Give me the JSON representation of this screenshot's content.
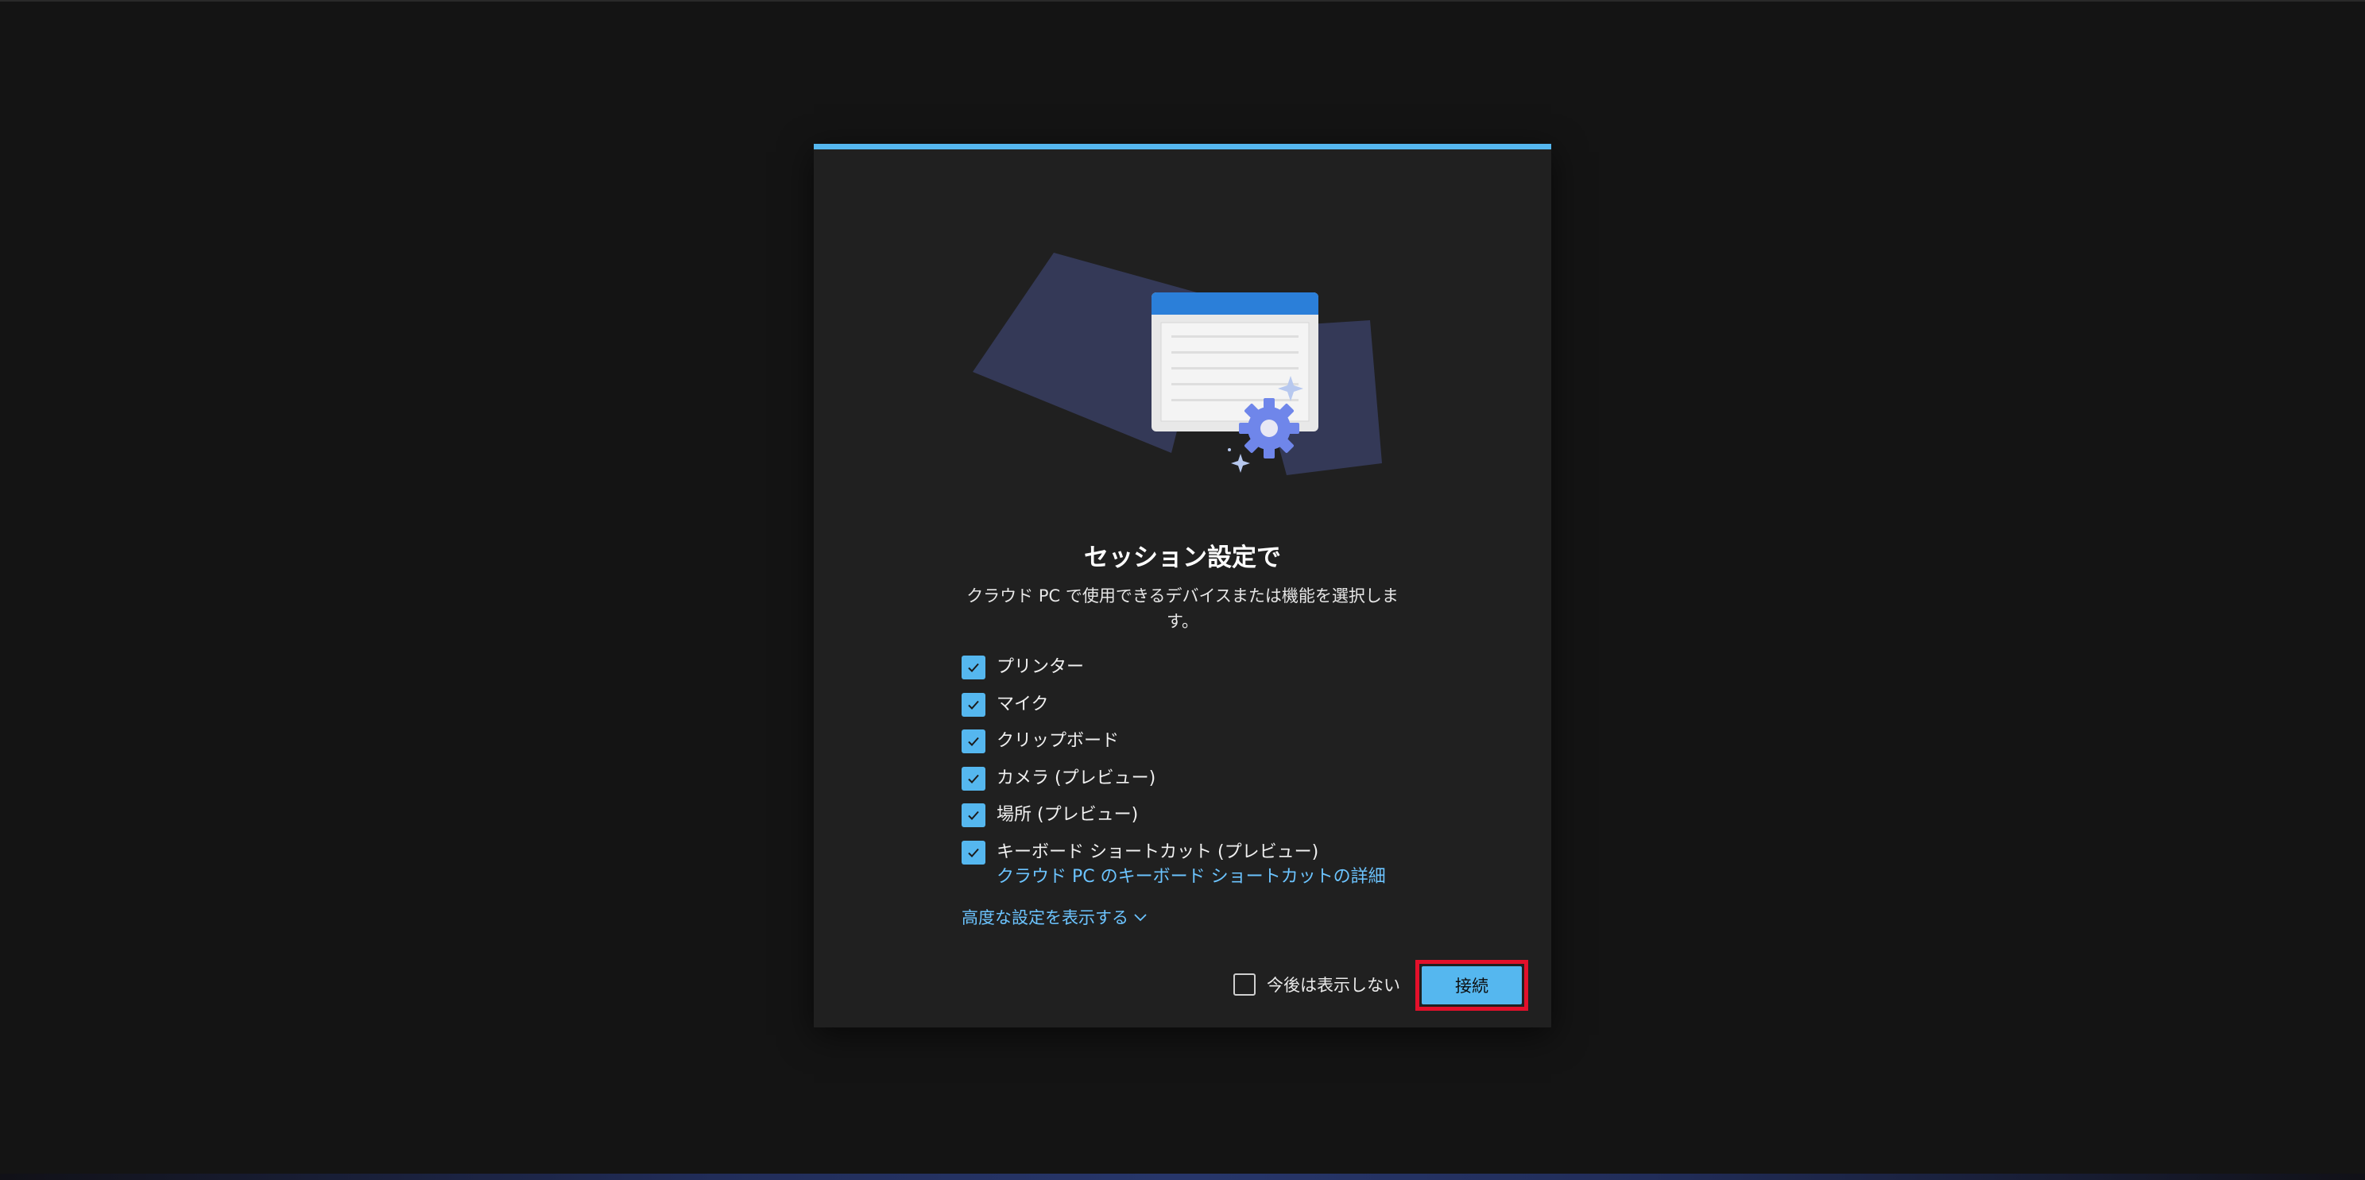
{
  "dialog": {
    "title": "セッション設定で",
    "description": "クラウド PC で使用できるデバイスまたは機能を選択します。",
    "options": [
      {
        "label": "プリンター",
        "checked": true
      },
      {
        "label": "マイク",
        "checked": true
      },
      {
        "label": "クリップボード",
        "checked": true
      },
      {
        "label": "カメラ (プレビュー)",
        "checked": true
      },
      {
        "label": "場所 (プレビュー)",
        "checked": true
      },
      {
        "label": "キーボード ショートカット (プレビュー)",
        "checked": true,
        "link": "クラウド PC のキーボード ショートカットの詳細"
      }
    ],
    "advanced_label": "高度な設定を表示する",
    "dont_show_label": "今後は表示しない",
    "dont_show_checked": false,
    "connect_label": "接続"
  },
  "colors": {
    "accent": "#55b7ef",
    "link": "#6cc4ff",
    "highlight": "#e3102b",
    "dialog_bg": "#202020",
    "screen_bg": "#141414"
  },
  "icons": {
    "illustration": "settings-window-gear-illustration",
    "checkmark": "checkmark-icon",
    "chevron": "chevron-down-icon"
  }
}
